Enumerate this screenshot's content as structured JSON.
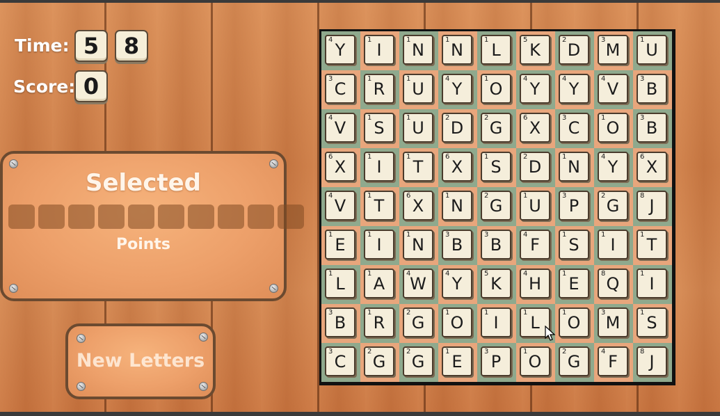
{
  "hud": {
    "time_label": "Time:",
    "time_digits": [
      "5",
      "8"
    ],
    "score_label": "Score:",
    "score_digits": [
      "0"
    ]
  },
  "selected_panel": {
    "title": "Selected",
    "slot_count": 10,
    "points_label": "Points"
  },
  "new_letters_button": {
    "label": "New Letters"
  },
  "board": {
    "rows": [
      [
        [
          "Y",
          "4"
        ],
        [
          "I",
          "1"
        ],
        [
          "N",
          "1"
        ],
        [
          "N",
          "1"
        ],
        [
          "L",
          "1"
        ],
        [
          "K",
          "5"
        ],
        [
          "D",
          "2"
        ],
        [
          "M",
          "3"
        ],
        [
          "U",
          "1"
        ]
      ],
      [
        [
          "C",
          "3"
        ],
        [
          "R",
          "1"
        ],
        [
          "U",
          "1"
        ],
        [
          "Y",
          "4"
        ],
        [
          "O",
          "1"
        ],
        [
          "Y",
          "4"
        ],
        [
          "Y",
          "4"
        ],
        [
          "V",
          "4"
        ],
        [
          "B",
          "3"
        ]
      ],
      [
        [
          "V",
          "4"
        ],
        [
          "S",
          "1"
        ],
        [
          "U",
          "1"
        ],
        [
          "D",
          "2"
        ],
        [
          "G",
          "2"
        ],
        [
          "X",
          "6"
        ],
        [
          "C",
          "3"
        ],
        [
          "O",
          "1"
        ],
        [
          "B",
          "3"
        ]
      ],
      [
        [
          "X",
          "6"
        ],
        [
          "I",
          "1"
        ],
        [
          "T",
          "1"
        ],
        [
          "X",
          "6"
        ],
        [
          "S",
          "1"
        ],
        [
          "D",
          "2"
        ],
        [
          "N",
          "1"
        ],
        [
          "Y",
          "4"
        ],
        [
          "X",
          "6"
        ]
      ],
      [
        [
          "V",
          "4"
        ],
        [
          "T",
          "1"
        ],
        [
          "X",
          "6"
        ],
        [
          "N",
          "1"
        ],
        [
          "G",
          "2"
        ],
        [
          "U",
          "1"
        ],
        [
          "P",
          "3"
        ],
        [
          "G",
          "2"
        ],
        [
          "J",
          "8"
        ]
      ],
      [
        [
          "E",
          "1"
        ],
        [
          "I",
          "1"
        ],
        [
          "N",
          "1"
        ],
        [
          "B",
          "3"
        ],
        [
          "B",
          "3"
        ],
        [
          "F",
          "4"
        ],
        [
          "S",
          "1"
        ],
        [
          "I",
          "1"
        ],
        [
          "T",
          "1"
        ]
      ],
      [
        [
          "L",
          "1"
        ],
        [
          "A",
          "1"
        ],
        [
          "W",
          "4"
        ],
        [
          "Y",
          "4"
        ],
        [
          "K",
          "5"
        ],
        [
          "H",
          "4"
        ],
        [
          "E",
          "1"
        ],
        [
          "Q",
          "8"
        ],
        [
          "I",
          "1"
        ]
      ],
      [
        [
          "B",
          "3"
        ],
        [
          "R",
          "1"
        ],
        [
          "G",
          "2"
        ],
        [
          "O",
          "1"
        ],
        [
          "I",
          "1"
        ],
        [
          "L",
          "1"
        ],
        [
          "O",
          "1"
        ],
        [
          "M",
          "3"
        ],
        [
          "S",
          "1"
        ]
      ],
      [
        [
          "C",
          "3"
        ],
        [
          "G",
          "2"
        ],
        [
          "G",
          "2"
        ],
        [
          "E",
          "1"
        ],
        [
          "P",
          "3"
        ],
        [
          "O",
          "1"
        ],
        [
          "G",
          "2"
        ],
        [
          "F",
          "4"
        ],
        [
          "J",
          "8"
        ]
      ]
    ]
  },
  "colors": {
    "cell_green": "#8fa98d",
    "cell_orange": "#e8a67c",
    "tile_face": "#f5eedb",
    "panel_border": "#6b4a30"
  }
}
